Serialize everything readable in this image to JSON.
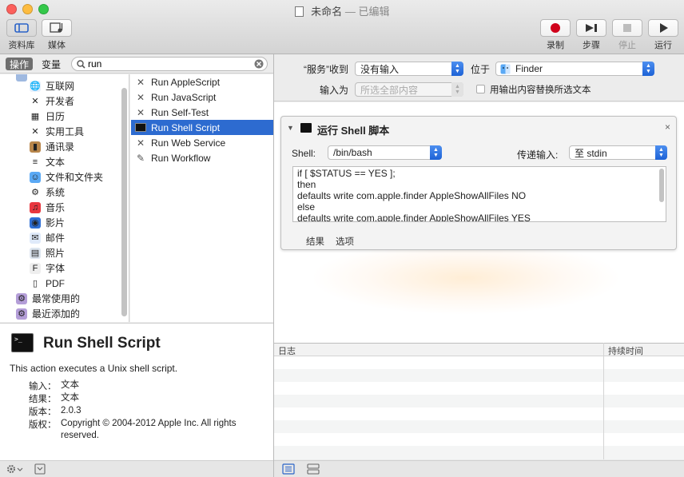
{
  "window": {
    "title": "未命名",
    "title_sep": "—",
    "edited_label": "已编辑"
  },
  "toolbar": {
    "library_label": "资料库",
    "media_label": "媒体",
    "record_label": "录制",
    "step_label": "步骤",
    "stop_label": "停止",
    "run_label": "运行"
  },
  "left_tabs": {
    "actions": "操作",
    "variables": "变量"
  },
  "search": {
    "value": "run"
  },
  "library": [
    {
      "label": "互联网",
      "icon": "globe-icon"
    },
    {
      "label": "开发者",
      "icon": "tools-icon"
    },
    {
      "label": "日历",
      "icon": "calendar-icon"
    },
    {
      "label": "实用工具",
      "icon": "tools-icon"
    },
    {
      "label": "通讯录",
      "icon": "contacts-icon"
    },
    {
      "label": "文本",
      "icon": "text-doc-icon"
    },
    {
      "label": "文件和文件夹",
      "icon": "finder-icon"
    },
    {
      "label": "系统",
      "icon": "system-icon"
    },
    {
      "label": "音乐",
      "icon": "music-icon"
    },
    {
      "label": "影片",
      "icon": "movie-icon"
    },
    {
      "label": "邮件",
      "icon": "mail-icon"
    },
    {
      "label": "照片",
      "icon": "photos-icon"
    },
    {
      "label": "字体",
      "icon": "font-icon"
    },
    {
      "label": "PDF",
      "icon": "pdf-icon"
    },
    {
      "label": "最常使用的",
      "icon": "smart-folder-icon"
    },
    {
      "label": "最近添加的",
      "icon": "smart-folder-icon"
    }
  ],
  "actions": [
    {
      "label": "Run AppleScript",
      "icon": "tools-icon"
    },
    {
      "label": "Run JavaScript",
      "icon": "tools-icon"
    },
    {
      "label": "Run Self-Test",
      "icon": "tools-icon"
    },
    {
      "label": "Run Shell Script",
      "icon": "terminal-icon"
    },
    {
      "label": "Run Web Service",
      "icon": "tools-icon"
    },
    {
      "label": "Run Workflow",
      "icon": "robot-icon"
    }
  ],
  "selected_action_index": 3,
  "description": {
    "title": "Run Shell Script",
    "summary": "This action executes a Unix shell script.",
    "input_key": "输入：",
    "input_val": "文本",
    "result_key": "结果：",
    "result_val": "文本",
    "version_key": "版本：",
    "version_val": "2.0.3",
    "copyright_key": "版权：",
    "copyright_val": "Copyright © 2004-2012 Apple Inc.  All rights reserved."
  },
  "workflow_input": {
    "service_receives_label": "“服务”收到",
    "service_receives_value": "没有输入",
    "located_in_label": "位于",
    "located_in_value": "Finder",
    "input_as_label": "输入为",
    "input_as_value": "所选全部内容",
    "replace_label": "用输出内容替换所选文本"
  },
  "action_card": {
    "title": "运行 Shell 脚本",
    "shell_label": "Shell:",
    "shell_value": "/bin/bash",
    "pass_input_label": "传递输入:",
    "pass_input_value": "至 stdin",
    "script_lines": [
      "if [ $STATUS == YES ];",
      "then",
      "defaults write com.apple.finder AppleShowAllFiles NO",
      "else",
      "defaults write com.apple.finder AppleShowAllFiles YES"
    ],
    "results_tab": "结果",
    "options_tab": "选项"
  },
  "log": {
    "col_log": "日志",
    "col_duration": "持续时间"
  },
  "colors": {
    "selection": "#2d6bd0",
    "record": "#d0021b",
    "popup_arrows": "#1d62d6"
  }
}
